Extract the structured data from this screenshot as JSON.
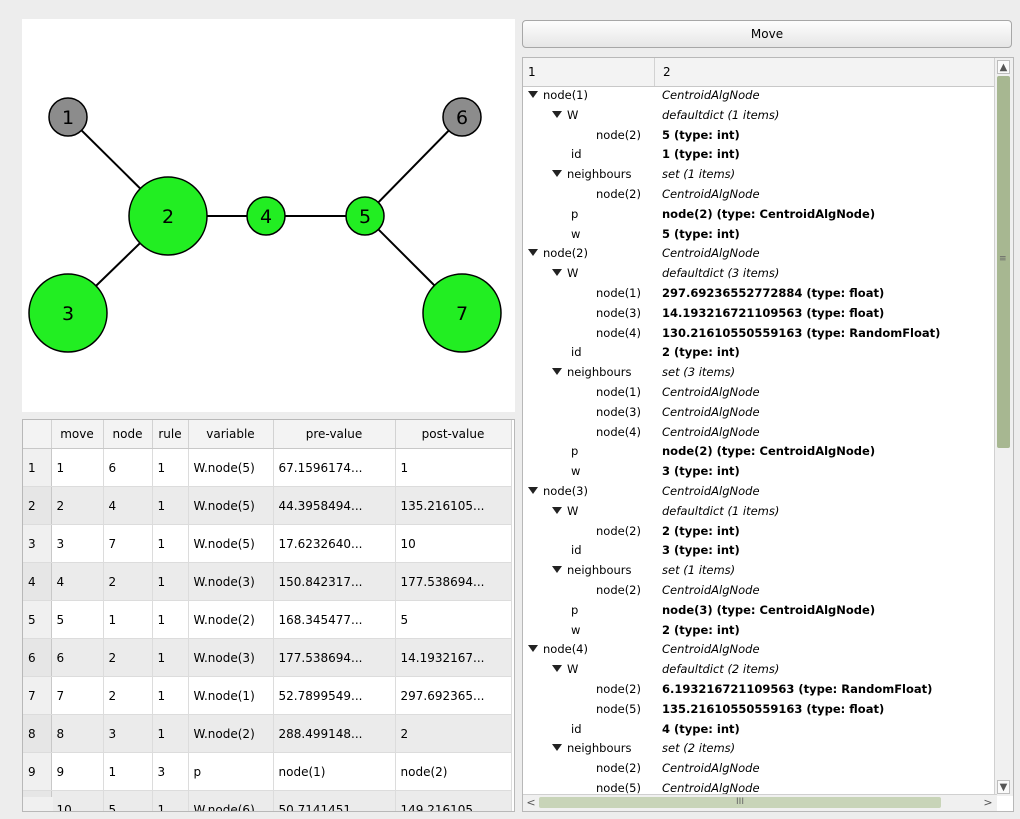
{
  "graph": {
    "nodes": [
      {
        "id": "1",
        "color": "#8c8c8c"
      },
      {
        "id": "2",
        "color": "#22ee22"
      },
      {
        "id": "3",
        "color": "#22ee22"
      },
      {
        "id": "4",
        "color": "#22ee22"
      },
      {
        "id": "5",
        "color": "#22ee22"
      },
      {
        "id": "6",
        "color": "#8c8c8c"
      },
      {
        "id": "7",
        "color": "#22ee22"
      }
    ],
    "edges": [
      [
        "1",
        "2"
      ],
      [
        "2",
        "3"
      ],
      [
        "2",
        "4"
      ],
      [
        "4",
        "5"
      ],
      [
        "5",
        "6"
      ],
      [
        "5",
        "7"
      ]
    ]
  },
  "table": {
    "headers": [
      "",
      "move",
      "node",
      "rule",
      "variable",
      "pre-value",
      "post-value"
    ],
    "rows": [
      [
        "1",
        "1",
        "6",
        "1",
        "W.node(5)",
        "67.1596174...",
        "1"
      ],
      [
        "2",
        "2",
        "4",
        "1",
        "W.node(5)",
        "44.3958494...",
        "135.216105..."
      ],
      [
        "3",
        "3",
        "7",
        "1",
        "W.node(5)",
        "17.6232640...",
        "10"
      ],
      [
        "4",
        "4",
        "2",
        "1",
        "W.node(3)",
        "150.842317...",
        "177.538694..."
      ],
      [
        "5",
        "5",
        "1",
        "1",
        "W.node(2)",
        "168.345477...",
        "5"
      ],
      [
        "6",
        "6",
        "2",
        "1",
        "W.node(3)",
        "177.538694...",
        "14.1932167..."
      ],
      [
        "7",
        "7",
        "2",
        "1",
        "W.node(1)",
        "52.7899549...",
        "297.692365..."
      ],
      [
        "8",
        "8",
        "3",
        "1",
        "W.node(2)",
        "288.499148...",
        "2"
      ],
      [
        "9",
        "9",
        "1",
        "3",
        "p",
        "node(1)",
        "node(2)"
      ],
      [
        "10",
        "10",
        "5",
        "1",
        "W.node(6)",
        "50.7141451...",
        "149.216105..."
      ]
    ]
  },
  "move_button": {
    "label": "Move"
  },
  "tree": {
    "col1": "1",
    "col2": "2",
    "rows": [
      {
        "level": 0,
        "exp": true,
        "key": "node(1)",
        "val": "CentroidAlgNode",
        "style": "italic"
      },
      {
        "level": 1,
        "exp": true,
        "key": "W",
        "val": "defaultdict (1 items)",
        "style": "italic"
      },
      {
        "level": 2,
        "exp": false,
        "key": "node(2)",
        "val": "5 (type: int)",
        "style": "bold"
      },
      {
        "level": 1,
        "exp": false,
        "key": "id",
        "val": "1 (type: int)",
        "style": "bold"
      },
      {
        "level": 1,
        "exp": true,
        "key": "neighbours",
        "val": "set (1 items)",
        "style": "italic"
      },
      {
        "level": 2,
        "exp": false,
        "key": "node(2)",
        "val": "CentroidAlgNode",
        "style": "italic"
      },
      {
        "level": 1,
        "exp": false,
        "key": "p",
        "val": "node(2) (type: CentroidAlgNode)",
        "style": "bold"
      },
      {
        "level": 1,
        "exp": false,
        "key": "w",
        "val": "5 (type: int)",
        "style": "bold"
      },
      {
        "level": 0,
        "exp": true,
        "key": "node(2)",
        "val": "CentroidAlgNode",
        "style": "italic"
      },
      {
        "level": 1,
        "exp": true,
        "key": "W",
        "val": "defaultdict (3 items)",
        "style": "italic"
      },
      {
        "level": 2,
        "exp": false,
        "key": "node(1)",
        "val": "297.69236552772884 (type: float)",
        "style": "bold"
      },
      {
        "level": 2,
        "exp": false,
        "key": "node(3)",
        "val": "14.193216721109563 (type: float)",
        "style": "bold"
      },
      {
        "level": 2,
        "exp": false,
        "key": "node(4)",
        "val": "130.21610550559163 (type: RandomFloat)",
        "style": "bold"
      },
      {
        "level": 1,
        "exp": false,
        "key": "id",
        "val": "2 (type: int)",
        "style": "bold"
      },
      {
        "level": 1,
        "exp": true,
        "key": "neighbours",
        "val": "set (3 items)",
        "style": "italic"
      },
      {
        "level": 2,
        "exp": false,
        "key": "node(1)",
        "val": "CentroidAlgNode",
        "style": "italic"
      },
      {
        "level": 2,
        "exp": false,
        "key": "node(3)",
        "val": "CentroidAlgNode",
        "style": "italic"
      },
      {
        "level": 2,
        "exp": false,
        "key": "node(4)",
        "val": "CentroidAlgNode",
        "style": "italic"
      },
      {
        "level": 1,
        "exp": false,
        "key": "p",
        "val": "node(2) (type: CentroidAlgNode)",
        "style": "bold"
      },
      {
        "level": 1,
        "exp": false,
        "key": "w",
        "val": "3 (type: int)",
        "style": "bold"
      },
      {
        "level": 0,
        "exp": true,
        "key": "node(3)",
        "val": "CentroidAlgNode",
        "style": "italic"
      },
      {
        "level": 1,
        "exp": true,
        "key": "W",
        "val": "defaultdict (1 items)",
        "style": "italic"
      },
      {
        "level": 2,
        "exp": false,
        "key": "node(2)",
        "val": "2 (type: int)",
        "style": "bold"
      },
      {
        "level": 1,
        "exp": false,
        "key": "id",
        "val": "3 (type: int)",
        "style": "bold"
      },
      {
        "level": 1,
        "exp": true,
        "key": "neighbours",
        "val": "set (1 items)",
        "style": "italic"
      },
      {
        "level": 2,
        "exp": false,
        "key": "node(2)",
        "val": "CentroidAlgNode",
        "style": "italic"
      },
      {
        "level": 1,
        "exp": false,
        "key": "p",
        "val": "node(3) (type: CentroidAlgNode)",
        "style": "bold"
      },
      {
        "level": 1,
        "exp": false,
        "key": "w",
        "val": "2 (type: int)",
        "style": "bold"
      },
      {
        "level": 0,
        "exp": true,
        "key": "node(4)",
        "val": "CentroidAlgNode",
        "style": "italic"
      },
      {
        "level": 1,
        "exp": true,
        "key": "W",
        "val": "defaultdict (2 items)",
        "style": "italic"
      },
      {
        "level": 2,
        "exp": false,
        "key": "node(2)",
        "val": "6.193216721109563 (type: RandomFloat)",
        "style": "bold"
      },
      {
        "level": 2,
        "exp": false,
        "key": "node(5)",
        "val": "135.21610550559163 (type: float)",
        "style": "bold"
      },
      {
        "level": 1,
        "exp": false,
        "key": "id",
        "val": "4 (type: int)",
        "style": "bold"
      },
      {
        "level": 1,
        "exp": true,
        "key": "neighbours",
        "val": "set (2 items)",
        "style": "italic"
      },
      {
        "level": 2,
        "exp": false,
        "key": "node(2)",
        "val": "CentroidAlgNode",
        "style": "italic"
      },
      {
        "level": 2,
        "exp": false,
        "key": "node(5)",
        "val": "CentroidAlgNode",
        "style": "italic"
      }
    ]
  },
  "scrollbar": {
    "grip": "≡",
    "hgrip": "III",
    "up": "▲",
    "down": "▼",
    "left": "<",
    "right": ">"
  }
}
